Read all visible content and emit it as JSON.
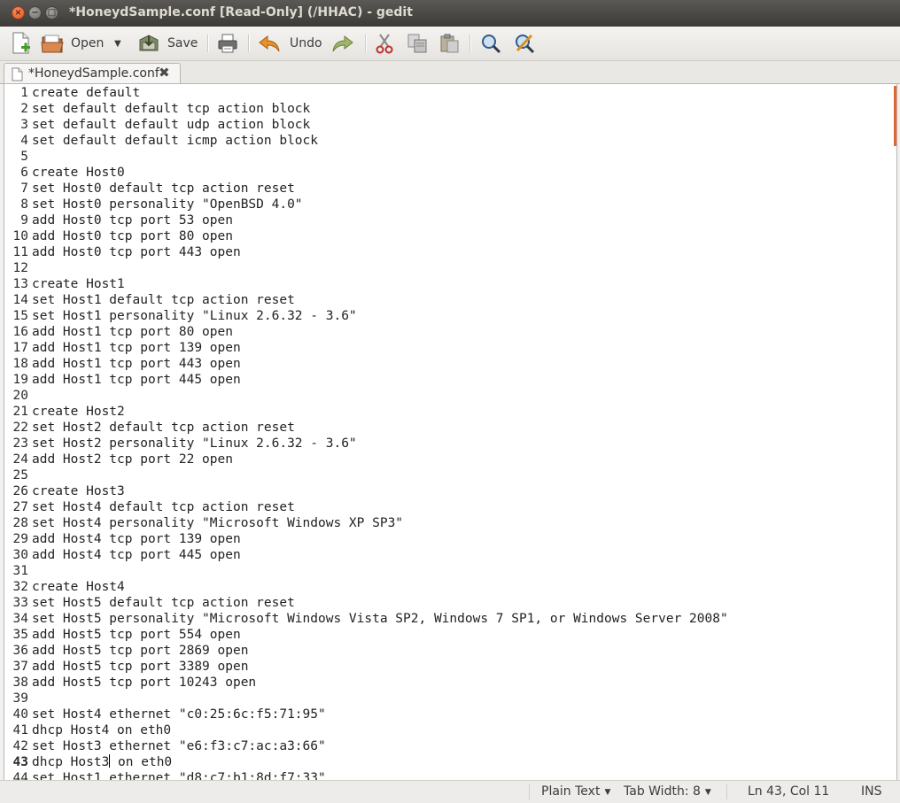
{
  "window": {
    "title": "*HoneydSample.conf [Read-Only] (/HHAC) - gedit"
  },
  "toolbar": {
    "open_label": "Open",
    "save_label": "Save",
    "undo_label": "Undo"
  },
  "tab": {
    "label": "*HoneydSample.conf"
  },
  "editor": {
    "current_line": 43,
    "lines": [
      {
        "n": "1",
        "t": "create default"
      },
      {
        "n": "2",
        "t": "set default default tcp action block"
      },
      {
        "n": "3",
        "t": "set default default udp action block"
      },
      {
        "n": "4",
        "t": "set default default icmp action block"
      },
      {
        "n": "5",
        "t": ""
      },
      {
        "n": "6",
        "t": "create Host0"
      },
      {
        "n": "7",
        "t": "set Host0 default tcp action reset"
      },
      {
        "n": "8",
        "t": "set Host0 personality \"OpenBSD 4.0\""
      },
      {
        "n": "9",
        "t": "add Host0 tcp port 53 open"
      },
      {
        "n": "10",
        "t": "add Host0 tcp port 80 open"
      },
      {
        "n": "11",
        "t": "add Host0 tcp port 443 open"
      },
      {
        "n": "12",
        "t": ""
      },
      {
        "n": "13",
        "t": "create Host1"
      },
      {
        "n": "14",
        "t": "set Host1 default tcp action reset"
      },
      {
        "n": "15",
        "t": "set Host1 personality \"Linux 2.6.32 - 3.6\""
      },
      {
        "n": "16",
        "t": "add Host1 tcp port 80 open"
      },
      {
        "n": "17",
        "t": "add Host1 tcp port 139 open"
      },
      {
        "n": "18",
        "t": "add Host1 tcp port 443 open"
      },
      {
        "n": "19",
        "t": "add Host1 tcp port 445 open"
      },
      {
        "n": "20",
        "t": ""
      },
      {
        "n": "21",
        "t": "create Host2"
      },
      {
        "n": "22",
        "t": "set Host2 default tcp action reset"
      },
      {
        "n": "23",
        "t": "set Host2 personality \"Linux 2.6.32 - 3.6\""
      },
      {
        "n": "24",
        "t": "add Host2 tcp port 22 open"
      },
      {
        "n": "25",
        "t": ""
      },
      {
        "n": "26",
        "t": "create Host3"
      },
      {
        "n": "27",
        "t": "set Host4 default tcp action reset"
      },
      {
        "n": "28",
        "t": "set Host4 personality \"Microsoft Windows XP SP3\""
      },
      {
        "n": "29",
        "t": "add Host4 tcp port 139 open"
      },
      {
        "n": "30",
        "t": "add Host4 tcp port 445 open"
      },
      {
        "n": "31",
        "t": ""
      },
      {
        "n": "32",
        "t": "create Host4"
      },
      {
        "n": "33",
        "t": "set Host5 default tcp action reset"
      },
      {
        "n": "34",
        "t": "set Host5 personality \"Microsoft Windows Vista SP2, Windows 7 SP1, or Windows Server 2008\""
      },
      {
        "n": "35",
        "t": "add Host5 tcp port 554 open"
      },
      {
        "n": "36",
        "t": "add Host5 tcp port 2869 open"
      },
      {
        "n": "37",
        "t": "add Host5 tcp port 3389 open"
      },
      {
        "n": "38",
        "t": "add Host5 tcp port 10243 open"
      },
      {
        "n": "39",
        "t": ""
      },
      {
        "n": "40",
        "t": "set Host4 ethernet \"c0:25:6c:f5:71:95\""
      },
      {
        "n": "41",
        "t": "dhcp Host4 on eth0"
      },
      {
        "n": "42",
        "t": "set Host3 ethernet \"e6:f3:c7:ac:a3:66\""
      },
      {
        "n": "43",
        "t": "dhcp Host3 on eth0"
      },
      {
        "n": "44",
        "t": "set Host1 ethernet \"d8:c7:b1:8d:f7:33\""
      }
    ]
  },
  "statusbar": {
    "language": "Plain Text",
    "tab_width": "Tab Width: 8",
    "position": "Ln 43, Col 11",
    "mode": "INS"
  },
  "colors": {
    "accent": "#e2662f",
    "titlebar": "#3c3b37"
  }
}
